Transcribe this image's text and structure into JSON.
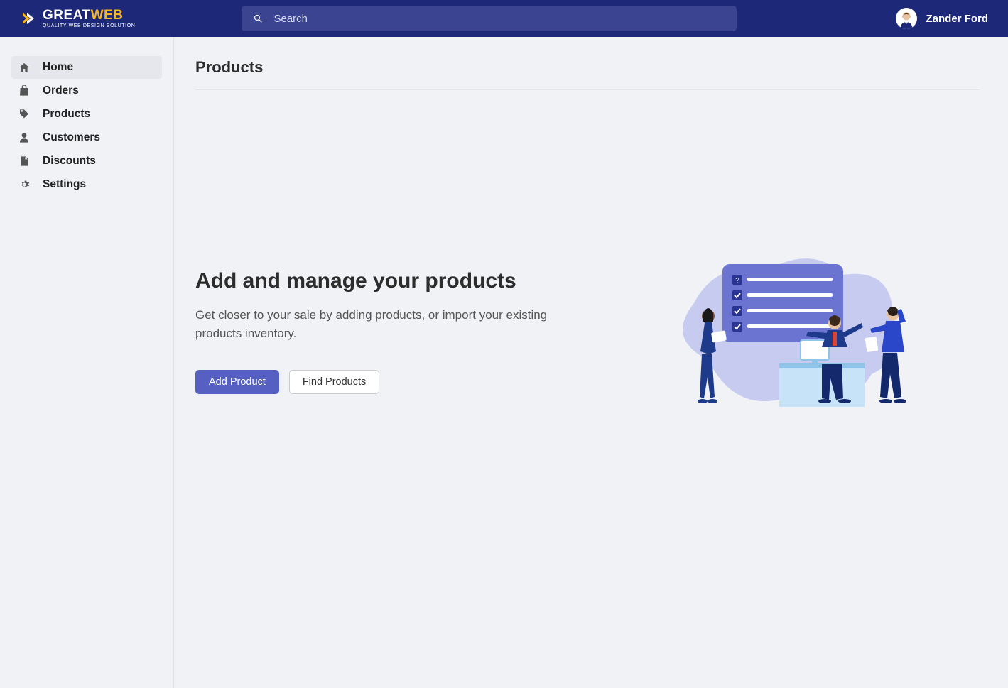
{
  "brand": {
    "name_part1": "GREAT",
    "name_part2": "WEB",
    "tagline": "QUALITY WEB DESIGN SOLUTION"
  },
  "search": {
    "placeholder": "Search"
  },
  "user": {
    "name": "Zander Ford"
  },
  "sidebar": {
    "items": [
      {
        "label": "Home",
        "icon": "home-icon",
        "active": true
      },
      {
        "label": "Orders",
        "icon": "bag-icon",
        "active": false
      },
      {
        "label": "Products",
        "icon": "tag-icon",
        "active": false
      },
      {
        "label": "Customers",
        "icon": "user-icon",
        "active": false
      },
      {
        "label": "Discounts",
        "icon": "file-icon",
        "active": false
      },
      {
        "label": "Settings",
        "icon": "gear-icon",
        "active": false
      }
    ]
  },
  "page": {
    "title": "Products",
    "heading": "Add and manage your products",
    "description": "Get closer to your sale by adding products, or import your existing products inventory.",
    "add_button": "Add Product",
    "find_button": "Find Products"
  }
}
